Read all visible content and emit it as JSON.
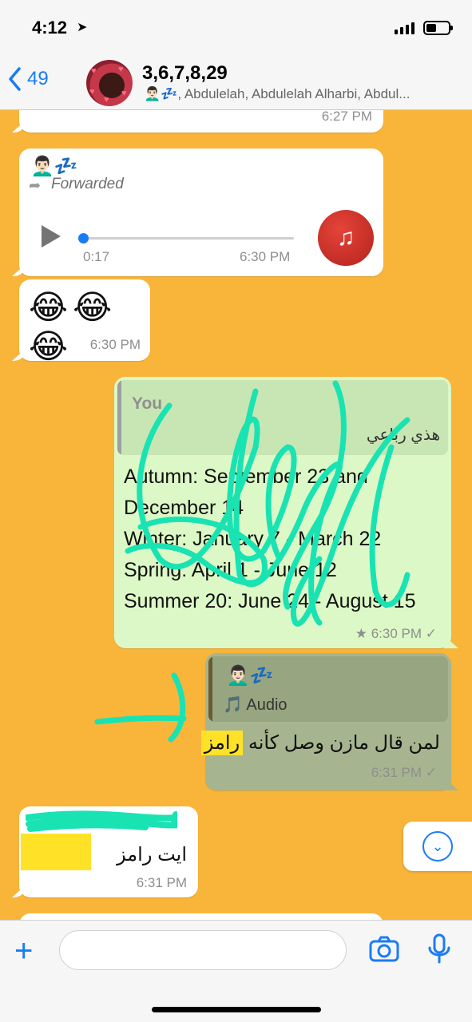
{
  "status_bar": {
    "time": "4:12"
  },
  "header": {
    "back_count": "49",
    "title": "3,6,7,8,29",
    "subtitle": "👨🏻‍🦱💤, Abdulelah, Abdulelah Alharbi, Abdul..."
  },
  "messages": {
    "top_partial_time": "6:27 PM",
    "forwarded": {
      "sender": "👨🏻‍🦱💤",
      "label": "Forwarded",
      "duration": "0:17",
      "time": "6:30 PM",
      "progress_fraction": 0.0
    },
    "emoji": {
      "text": "😂😂😂",
      "time": "6:30 PM"
    },
    "outgoing_schedule": {
      "quote_name": "You",
      "quote_text": "هذي رباعي",
      "lines": [
        "Autumn: September 23 and",
        "December 14",
        "Winter: January 7 - March 22",
        "Spring: April 1 - June 12",
        "Summer 20: June 24 - August 15"
      ],
      "time": "6:30 PM"
    },
    "outgoing_audio_reply": {
      "quote_name": "👨🏻‍🦱💤",
      "quote_label": "🎵 Audio",
      "text_main": "لمن قال مازن وصل كأنه ",
      "text_highlight": "رامز",
      "time": "6:31 PM"
    },
    "incoming_last": {
      "text": "ايت رامز",
      "time": "6:31 PM"
    }
  },
  "composer": {
    "placeholder": ""
  },
  "colors": {
    "wallpaper": "#f9b53a",
    "accent": "#1a7cf5",
    "out_bubble": "#dcf8c6",
    "highlight": "#ffe228",
    "scribble": "#19e3b2"
  }
}
